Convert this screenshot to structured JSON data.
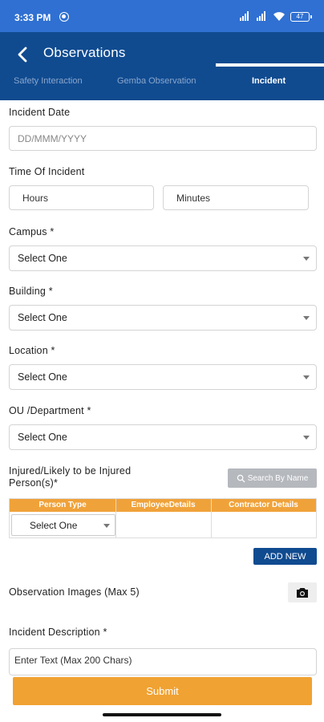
{
  "status_bar": {
    "time": "3:33 PM",
    "battery": "47"
  },
  "header": {
    "title": "Observations"
  },
  "tabs": [
    {
      "label": "Safety Interaction",
      "active": false
    },
    {
      "label": "Gemba Observation",
      "active": false
    },
    {
      "label": "Incident",
      "active": true
    }
  ],
  "form": {
    "incident_date": {
      "label": "Incident Date",
      "placeholder": "DD/MMM/YYYY"
    },
    "time_of_incident": {
      "label": "Time Of Incident",
      "hours_placeholder": "Hours",
      "minutes_placeholder": "Minutes"
    },
    "campus": {
      "label": "Campus *",
      "value": "Select One"
    },
    "building": {
      "label": "Building *",
      "value": "Select One"
    },
    "location": {
      "label": "Location *",
      "value": "Select One"
    },
    "department": {
      "label": "OU /Department *",
      "value": "Select One"
    },
    "injured": {
      "label_line1": "Injured/Likely to be Injured",
      "label_line2": "Person(s)*",
      "search_button": "Search By Name",
      "table_headers": [
        "Person Type",
        "EmployeeDetails",
        "Contractor Details"
      ],
      "person_type_value": "Select One",
      "add_new_button": "ADD NEW"
    },
    "observation_images": {
      "label": "Observation Images (Max 5)"
    },
    "incident_description": {
      "label": "Incident Description *",
      "placeholder": "Enter Text (Max 200 Chars)"
    }
  },
  "submit_button": "Submit",
  "colors": {
    "status_bar": "#2f70d2",
    "header": "#104b90",
    "accent": "#f0a232"
  }
}
